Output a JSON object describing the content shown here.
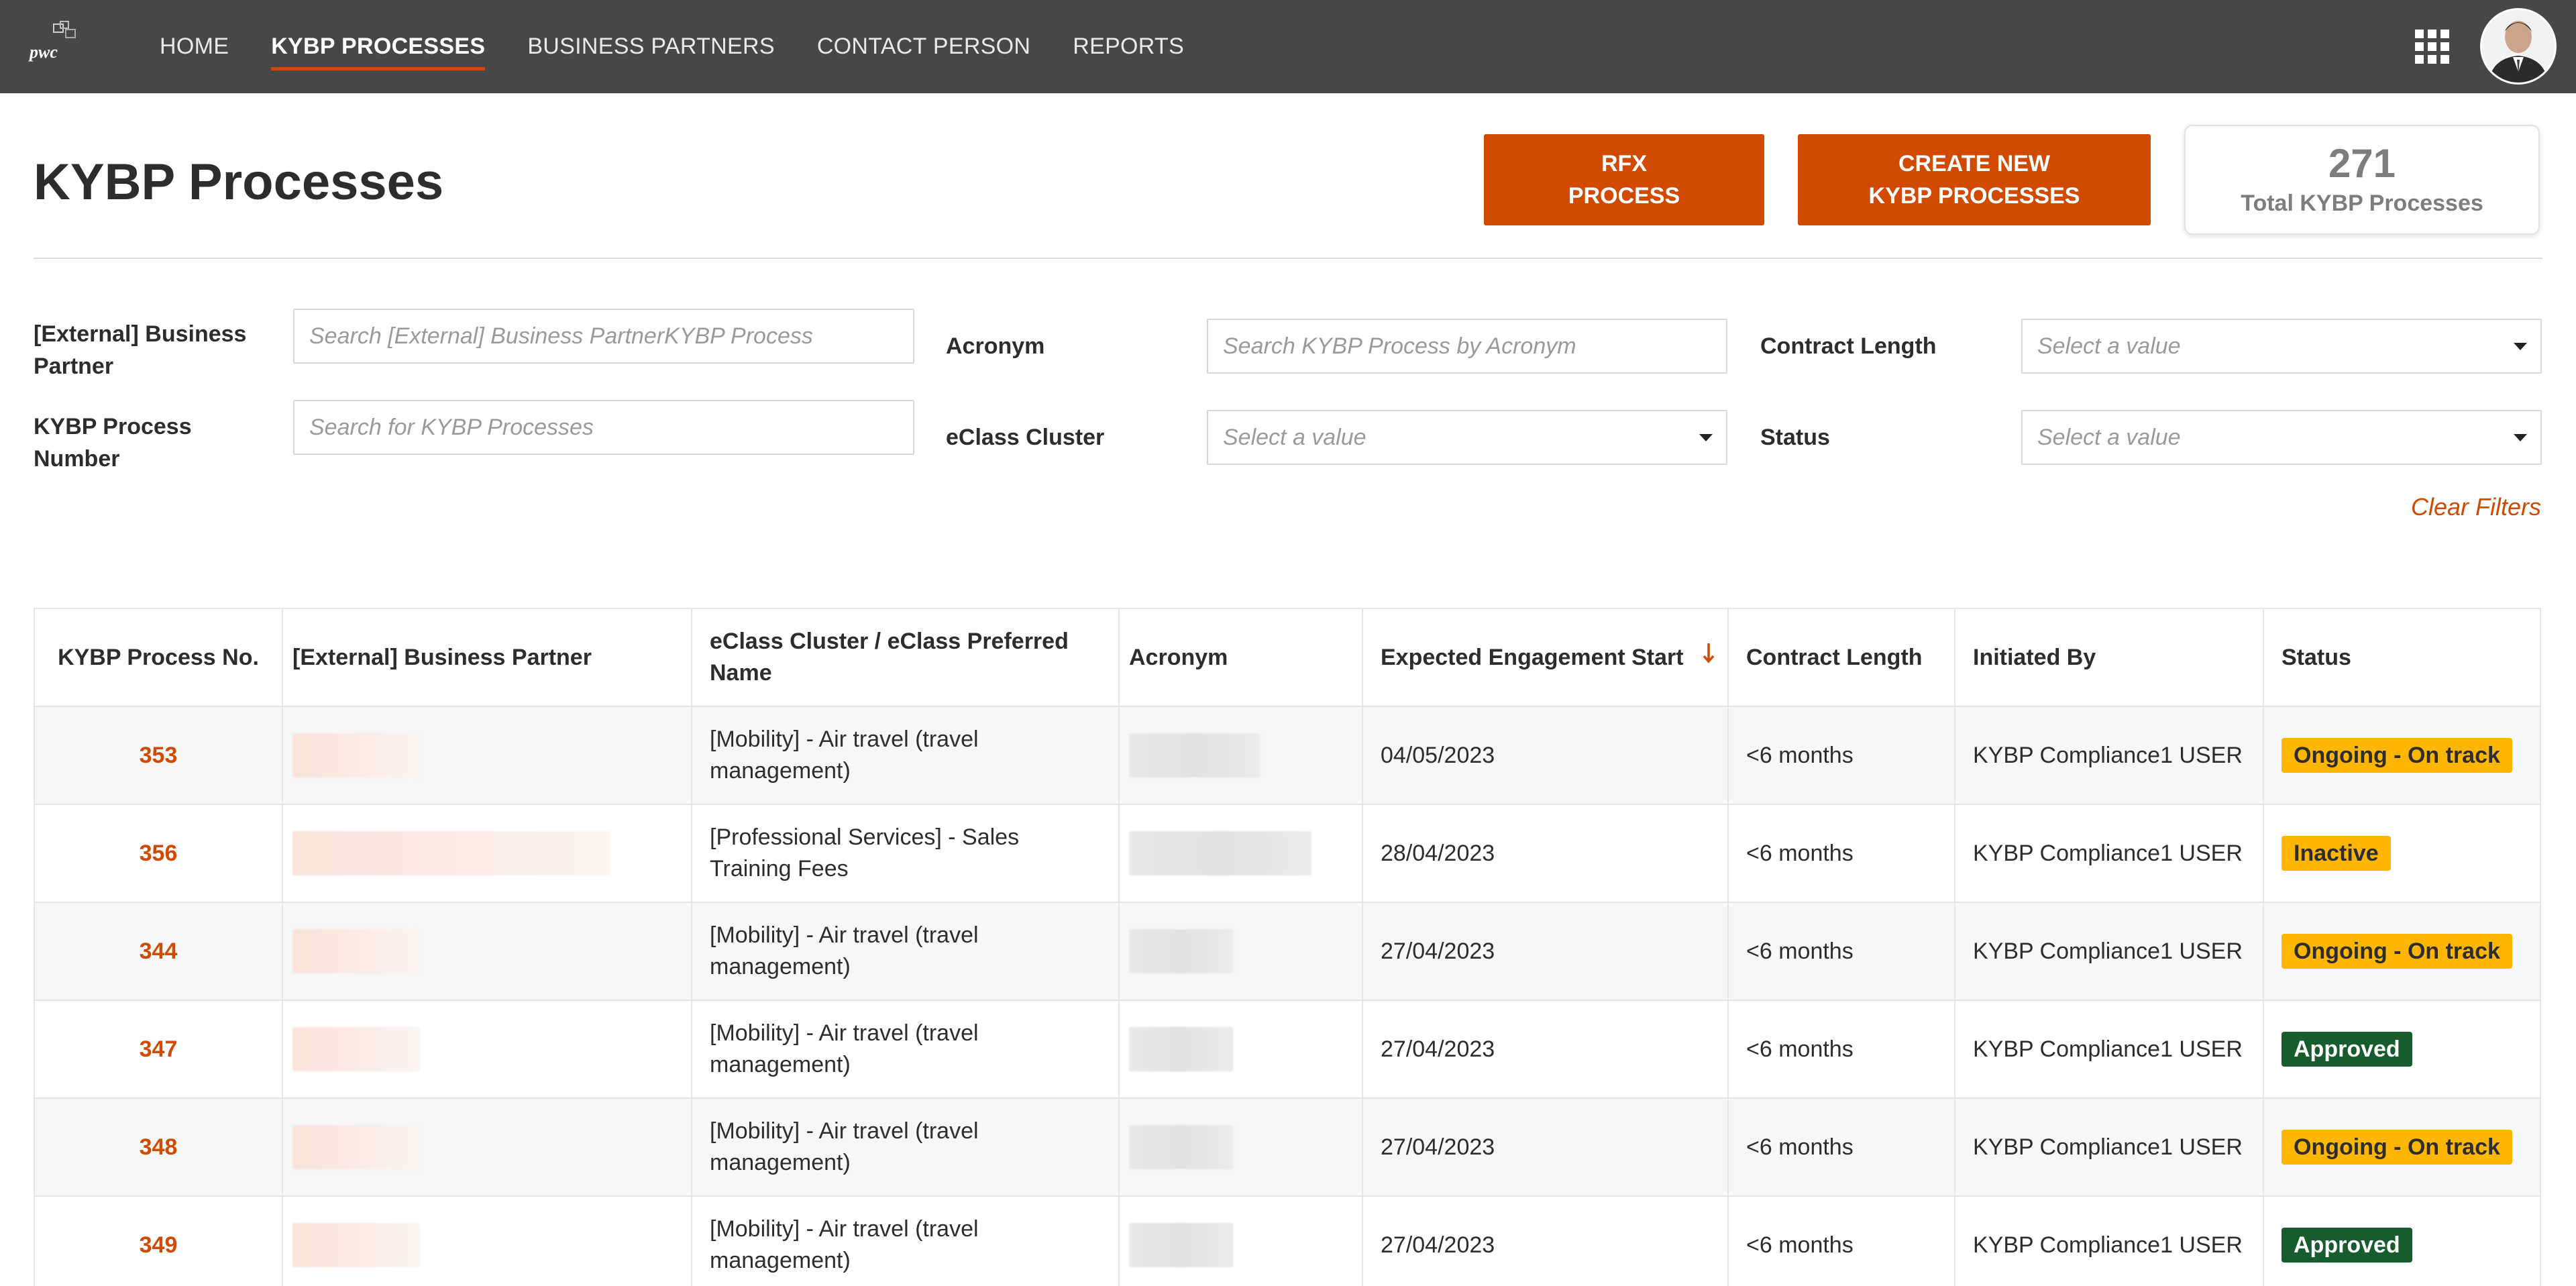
{
  "nav": {
    "logo_text": "pwc",
    "items": [
      {
        "label": "HOME",
        "active": false
      },
      {
        "label": "KYBP PROCESSES",
        "active": true
      },
      {
        "label": "BUSINESS PARTNERS",
        "active": false
      },
      {
        "label": "CONTACT PERSON",
        "active": false
      },
      {
        "label": "REPORTS",
        "active": false
      }
    ],
    "apps_icon": "apps-grid-icon",
    "avatar_icon": "user-avatar"
  },
  "header": {
    "title": "KYBP Processes",
    "rfx_button": {
      "line1": "RFX",
      "line2": "PROCESS"
    },
    "create_button": {
      "line1": "CREATE NEW",
      "line2": "KYBP PROCESSES"
    },
    "total": {
      "value": "271",
      "label": "Total KYBP Processes"
    }
  },
  "filters": {
    "business_partner": {
      "label_line1": "[External] Business",
      "label_line2": "Partner",
      "placeholder": "Search [External] Business PartnerKYBP Process"
    },
    "process_number": {
      "label_line1": "KYBP Process",
      "label_line2": "Number",
      "placeholder": "Search for KYBP Processes"
    },
    "acronym": {
      "label": "Acronym",
      "placeholder": "Search KYBP Process by Acronym"
    },
    "eclass_cluster": {
      "label": "eClass Cluster",
      "placeholder": "Select a value"
    },
    "contract_length": {
      "label": "Contract Length",
      "placeholder": "Select a value"
    },
    "status": {
      "label": "Status",
      "placeholder": "Select a value"
    },
    "clear_label": "Clear Filters"
  },
  "table": {
    "headers": {
      "process_no": "KYBP Process No.",
      "partner": "[External] Business Partner",
      "eclass_line1": "eClass Cluster / eClass Preferred",
      "eclass_line2": "Name",
      "acronym": "Acronym",
      "engagement": "Expected Engagement Start",
      "contract": "Contract Length",
      "initiated": "Initiated By",
      "status": "Status"
    },
    "sort_icon": "arrow-down-icon",
    "rows": [
      {
        "no": "353",
        "eclass_line1": "[Mobility]  -  Air travel (travel",
        "eclass_line2": "management)",
        "start": "04/05/2023",
        "contract": "<6 months",
        "initiated": "KYBP Compliance1 USER",
        "status": "Ongoing - On track",
        "status_kind": "ongoing"
      },
      {
        "no": "356",
        "eclass_line1": "[Professional Services]  -  Sales",
        "eclass_line2": "Training Fees",
        "start": "28/04/2023",
        "contract": "<6 months",
        "initiated": "KYBP Compliance1 USER",
        "status": "Inactive",
        "status_kind": "inactive"
      },
      {
        "no": "344",
        "eclass_line1": "[Mobility]  -  Air travel (travel",
        "eclass_line2": "management)",
        "start": "27/04/2023",
        "contract": "<6 months",
        "initiated": "KYBP Compliance1 USER",
        "status": "Ongoing - On track",
        "status_kind": "ongoing"
      },
      {
        "no": "347",
        "eclass_line1": "[Mobility]  -  Air travel (travel",
        "eclass_line2": "management)",
        "start": "27/04/2023",
        "contract": "<6 months",
        "initiated": "KYBP Compliance1 USER",
        "status": "Approved",
        "status_kind": "approved"
      },
      {
        "no": "348",
        "eclass_line1": "[Mobility]  -  Air travel (travel",
        "eclass_line2": "management)",
        "start": "27/04/2023",
        "contract": "<6 months",
        "initiated": "KYBP Compliance1 USER",
        "status": "Ongoing - On track",
        "status_kind": "ongoing"
      },
      {
        "no": "349",
        "eclass_line1": "[Mobility]  -  Air travel (travel",
        "eclass_line2": "management)",
        "start": "27/04/2023",
        "contract": "<6 months",
        "initiated": "KYBP Compliance1 USER",
        "status": "Approved",
        "status_kind": "approved"
      }
    ]
  },
  "colors": {
    "accent": "#d04a02",
    "topbar": "#474747",
    "badge_ongoing": "#ffb600",
    "badge_approved": "#175c2c"
  }
}
